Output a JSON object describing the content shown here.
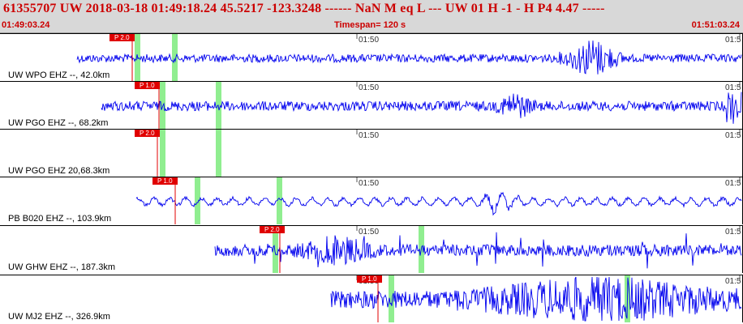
{
  "header": {
    "title": "61355707 UW 2018-03-18 01:49:18.24   45.5217 -123.3248 ------   NaN M   eq  L ---      UW 01  H  -1  -  H P4    4.47 -----",
    "start_time": "01:49:03.24",
    "timespan": "Timespan= 120 s",
    "end_time": "01:51:03.24"
  },
  "tick_labels": {
    "mid": "01:50",
    "right": "01:5"
  },
  "colors": {
    "trace": "#0000ee",
    "pick": "#e00000",
    "window": "#90ee90",
    "header_text": "#cc0000"
  },
  "traces": [
    {
      "station": "UW WPO EHZ --, 42.0km",
      "pick_label": "P 2.0"
    },
    {
      "station": "UW PGO EHZ --, 68.2km",
      "pick_label": "P 1.0"
    },
    {
      "station": "UW PGO EHZ 20,68.3km",
      "pick_label": "P 2.0"
    },
    {
      "station": "PB B020 EHZ --, 103.9km",
      "pick_label": "P 1.0"
    },
    {
      "station": "UW GHW EHZ --, 187.3km",
      "pick_label": "P 2.0"
    },
    {
      "station": "UW MJ2 EHZ --, 326.9km",
      "pick_label": "P 1.0"
    }
  ]
}
